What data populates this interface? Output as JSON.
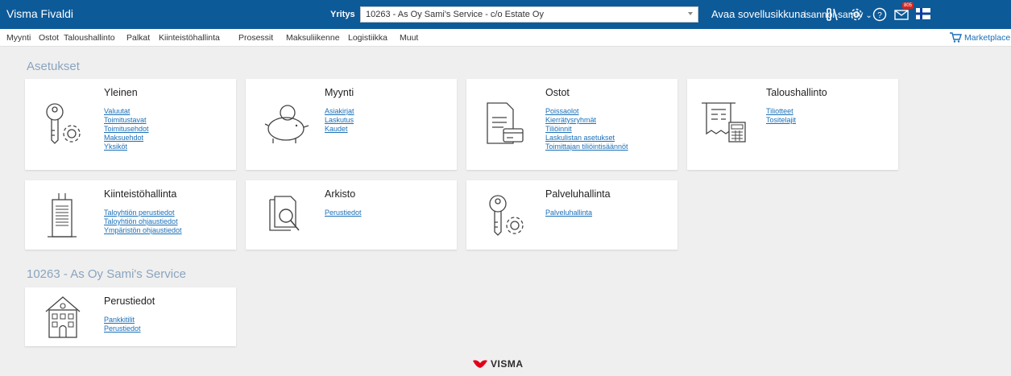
{
  "topbar": {
    "app_name": "Visma Fivaldi",
    "company_label": "Yritys",
    "company_value": "10263 - As Oy Sami's Service - c/o Estate Oy",
    "open_app": "Avaa sovellusikkuna",
    "notification_count": "805",
    "user": "isannoi-samiv"
  },
  "menu": [
    "Myynti",
    "Ostot",
    "Taloushallinto",
    "Palkat",
    "Kiinteistöhallinta",
    "Prosessit",
    "Maksuliikenne",
    "Logistiikka",
    "Muut"
  ],
  "marketplace": "Marketplace",
  "settings": {
    "title": "Asetukset",
    "cards": [
      {
        "title": "Yleinen",
        "links": [
          "Valuutat",
          "Toimitustavat",
          "Toimitusehdot",
          "Maksuehdot",
          "Yksiköt"
        ],
        "icon": "key-gear-icon"
      },
      {
        "title": "Myynti",
        "links": [
          "Asiakirjat",
          "Laskutus",
          "Kaudet"
        ],
        "icon": "piggy-bank-icon"
      },
      {
        "title": "Ostot",
        "links": [
          "Poissaolot",
          "Kierrätysryhmät",
          "Tiliöinnit",
          "Laskulistan asetukset",
          "Toimittajan tiliöintisäännöt"
        ],
        "icon": "invoice-card-icon"
      },
      {
        "title": "Taloushallinto",
        "links": [
          "Tiliotteet",
          "Tositelajit"
        ],
        "icon": "receipt-calculator-icon"
      },
      {
        "title": "Kiinteistöhallinta",
        "links": [
          "Taloyhtiön perustiedot",
          "Taloyhtiön ohjaustiedot",
          "Ympäristön ohjaustiedot"
        ],
        "icon": "building-icon"
      },
      {
        "title": "Arkisto",
        "links": [
          "Perustiedot"
        ],
        "icon": "document-search-icon"
      },
      {
        "title": "Palveluhallinta",
        "links": [
          "Palveluhallinta"
        ],
        "icon": "key-gear-icon"
      }
    ]
  },
  "company_section": {
    "title": "10263 - As Oy Sami's Service",
    "cards": [
      {
        "title": "Perustiedot",
        "links": [
          "Pankkitilit",
          "Perustiedot"
        ],
        "icon": "house-icon"
      }
    ]
  },
  "footer": {
    "logo_text": "VISMA"
  },
  "colors": {
    "topbar": "#0d5a99",
    "link": "#1a6fb8",
    "section_title": "#8aa4bf",
    "background": "#efefef",
    "visma_red": "#e2001a"
  }
}
